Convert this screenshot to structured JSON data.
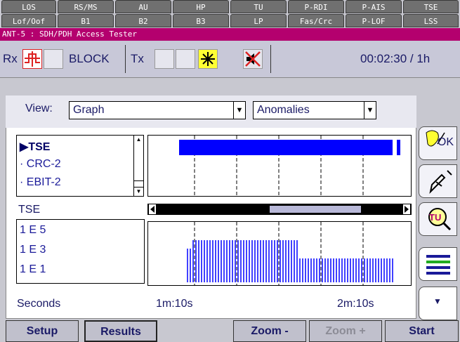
{
  "alarm_tabs_row1": [
    "LOS",
    "RS/MS",
    "AU",
    "HP",
    "TU",
    "P-RDI",
    "P-AIS",
    "TSE"
  ],
  "alarm_tabs_row2": [
    "Lof/Oof",
    "B1",
    "B2",
    "B3",
    "LP",
    "Fas/Crc",
    "P-LOF",
    "LSS"
  ],
  "title": "ANT-5 : SDH/PDH Access Tester",
  "status": {
    "rx_label": "Rx",
    "block_label": "BLOCK",
    "tx_label": "Tx",
    "timer": "00:02:30 / 1h"
  },
  "view": {
    "label": "View:",
    "mode_value": "Graph",
    "type_value": "Anomalies"
  },
  "list": {
    "items": [
      "TSE",
      "CRC-2",
      "EBIT-2"
    ],
    "selected": "TSE"
  },
  "scale": {
    "section_label": "TSE",
    "levels": [
      "1 E 5",
      "1 E 3",
      "1 E 1"
    ]
  },
  "axis": {
    "unit": "Seconds",
    "tick1": "1m:10s",
    "tick2": "2m:10s"
  },
  "side_tabs": [
    "OK",
    "inject",
    "TU",
    "list",
    "down"
  ],
  "bottom": {
    "setup": "Setup",
    "results": "Results",
    "zoom_minus": "Zoom -",
    "zoom_plus": "Zoom +",
    "start": "Start"
  },
  "colors": {
    "title_bar": "#b4006e",
    "graph_bar": "#0000ff",
    "tab_gray": "#707070"
  }
}
